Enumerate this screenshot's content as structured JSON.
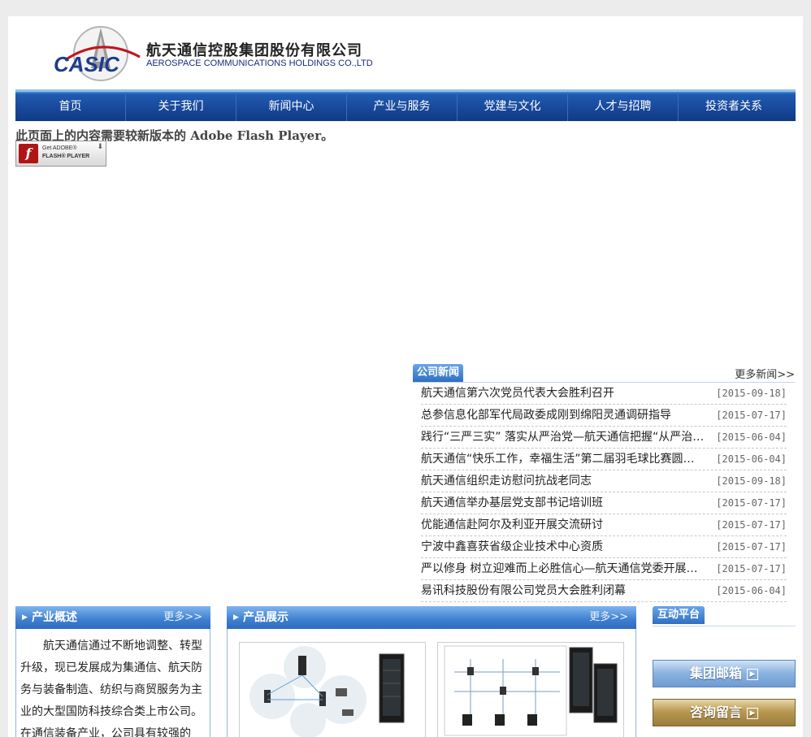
{
  "header": {
    "logo_text": "CASIC",
    "company_cn": "航天通信控股集团股份有限公司",
    "company_en": "AEROSPACE COMMUNICATIONS HOLDINGS CO.,LTD"
  },
  "nav": {
    "items": [
      "首页",
      "关于我们",
      "新闻中心",
      "产业与服务",
      "党建与文化",
      "人才与招聘",
      "投资者关系"
    ]
  },
  "flash": {
    "notice": "此页面上的内容需要较新版本的 Adobe Flash Player。",
    "badge_line1": "Get ADOBE®",
    "badge_line2": "FLASH® PLAYER"
  },
  "news": {
    "title": "公司新闻",
    "more": "更多新闻>>",
    "items": [
      {
        "title": "航天通信第六次党员代表大会胜利召开",
        "date": "[2015-09-18]"
      },
      {
        "title": "总参信息化部军代局政委成刚到绵阳灵通调研指导",
        "date": "[2015-07-17]"
      },
      {
        "title": "践行“三严三实” 落实从严治党—航天通信把握“从严治党”",
        "date": "[2015-06-04]"
      },
      {
        "title": "航天通信“快乐工作，幸福生活”第二届羽毛球比赛圆满落幕",
        "date": "[2015-06-04]"
      },
      {
        "title": "航天通信组织走访慰问抗战老同志",
        "date": "[2015-09-18]"
      },
      {
        "title": "航天通信举办基层党支部书记培训班",
        "date": "[2015-07-17]"
      },
      {
        "title": "优能通信赴阿尔及利亚开展交流研讨",
        "date": "[2015-07-17]"
      },
      {
        "title": "宁波中鑫喜获省级企业技术中心资质",
        "date": "[2015-07-17]"
      },
      {
        "title": "严以修身 树立迎难而上必胜信心—航天通信党委开展专题学习",
        "date": "[2015-07-17]"
      },
      {
        "title": "易讯科技股份有限公司党员大会胜利闭幕",
        "date": "[2015-06-04]"
      }
    ]
  },
  "overview": {
    "title": "产业概述",
    "more": "更多>>",
    "text": "航天通信通过不断地调整、转型升级，现已发展成为集通信、航天防务与装备制造、纺织与商贸服务为主业的大型国防科技综合类上市公司。在通信装备产业，公司具有较强的"
  },
  "products": {
    "title": "产品展示",
    "more": "更多>>"
  },
  "platform": {
    "title": "互动平台",
    "mail": "集团邮箱",
    "consult": "咨询留言"
  },
  "colors": {
    "nav_dark": "#19499b",
    "nav_light": "#8fc2ee",
    "accent_blue": "#2e6fc0",
    "consult_gold": "#b99a52"
  }
}
